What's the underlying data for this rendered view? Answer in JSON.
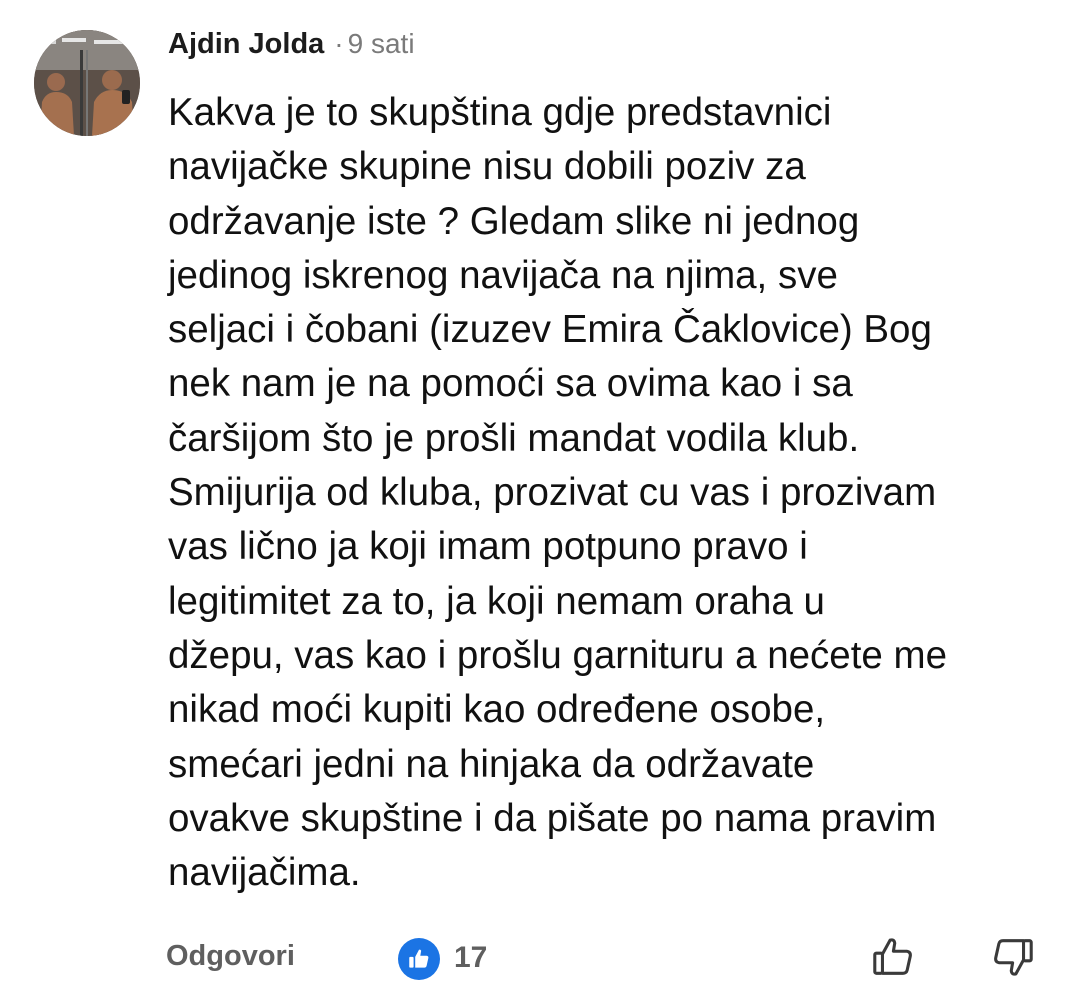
{
  "comment": {
    "author": "Ajdin Jolda",
    "separator": "·",
    "time": "9 sati",
    "avatar_icon": "profile-photo-icon",
    "lines": [
      "Kakva je to skupština gdje predstavnici",
      "navijačke skupine nisu dobili poziv za",
      "održavanje iste ? Gledam slike ni jednog",
      "jedinog iskrenog navijača na njima, sve",
      "seljaci i čobani (izuzev Emira Čaklovice) Bog",
      "nek nam je na pomoći sa ovima kao i sa",
      "čaršijom što je prošli mandat vodila klub.",
      "Smijurija od kluba, prozivat cu vas i prozivam",
      "vas lično ja koji imam potpuno pravo i",
      "legitimitet za to, ja koji nemam oraha u",
      "džepu, vas kao i prošlu garnituru a nećete me",
      "nikad moći kupiti kao određene osobe,",
      "smećari jedni na hinjaka da održavate",
      "ovakve skupštine i da pišate po nama pravim",
      "navijačima."
    ]
  },
  "actions": {
    "reply_label": "Odgovori",
    "like_count": "17",
    "like_badge_icon": "like-badge-icon",
    "like_button_icon": "thumbs-up-icon",
    "dislike_button_icon": "thumbs-down-icon"
  },
  "colors": {
    "like_blue": "#1b74e4",
    "secondary_text": "#5f5f5f",
    "meta_text": "#7a7a7a"
  }
}
